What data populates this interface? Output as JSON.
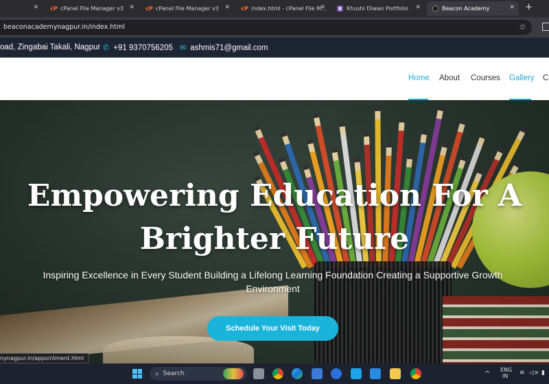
{
  "browser": {
    "tabs": [
      {
        "title": "",
        "favicon": "none"
      },
      {
        "title": "cPanel File Manager v3",
        "favicon": "cpanel-icon"
      },
      {
        "title": "cPanel File Manager v3",
        "favicon": "cpanel-icon"
      },
      {
        "title": "index.html - cPanel File M...",
        "favicon": "cpanel-icon"
      },
      {
        "title": "Khushi Diwan Portfolio",
        "favicon": "bootstrap-icon"
      },
      {
        "title": "Beacon Academy",
        "favicon": "beacon-icon",
        "active": true
      }
    ],
    "url": "beaconacademynagpur.in/index.html",
    "status_url": "nynagpur.in/appointment.html"
  },
  "topbar": {
    "address": "oad, Zingabai Takali, Nagpur",
    "phone": "+91 9370756205",
    "email": "ashmis71@gmail.com"
  },
  "nav": {
    "links": [
      "Home",
      "About",
      "Courses",
      "Gallery",
      "C"
    ],
    "active": "Home"
  },
  "hero": {
    "title_line1": "Empowering Education For A",
    "title_line2": "Brighter Future",
    "subtitle": "Inspiring Excellence in Every Student Building a Lifelong Learning Foundation Creating a Supportive Growth Environment",
    "cta_label": "Schedule Your Visit Today"
  },
  "taskbar": {
    "search_placeholder": "Search",
    "lang_line1": "ENG",
    "lang_line2": "IN"
  },
  "colors": {
    "accent": "#1fa8d9",
    "topbar_bg": "#1d2532",
    "cta_bg": "#1ab3d9"
  }
}
